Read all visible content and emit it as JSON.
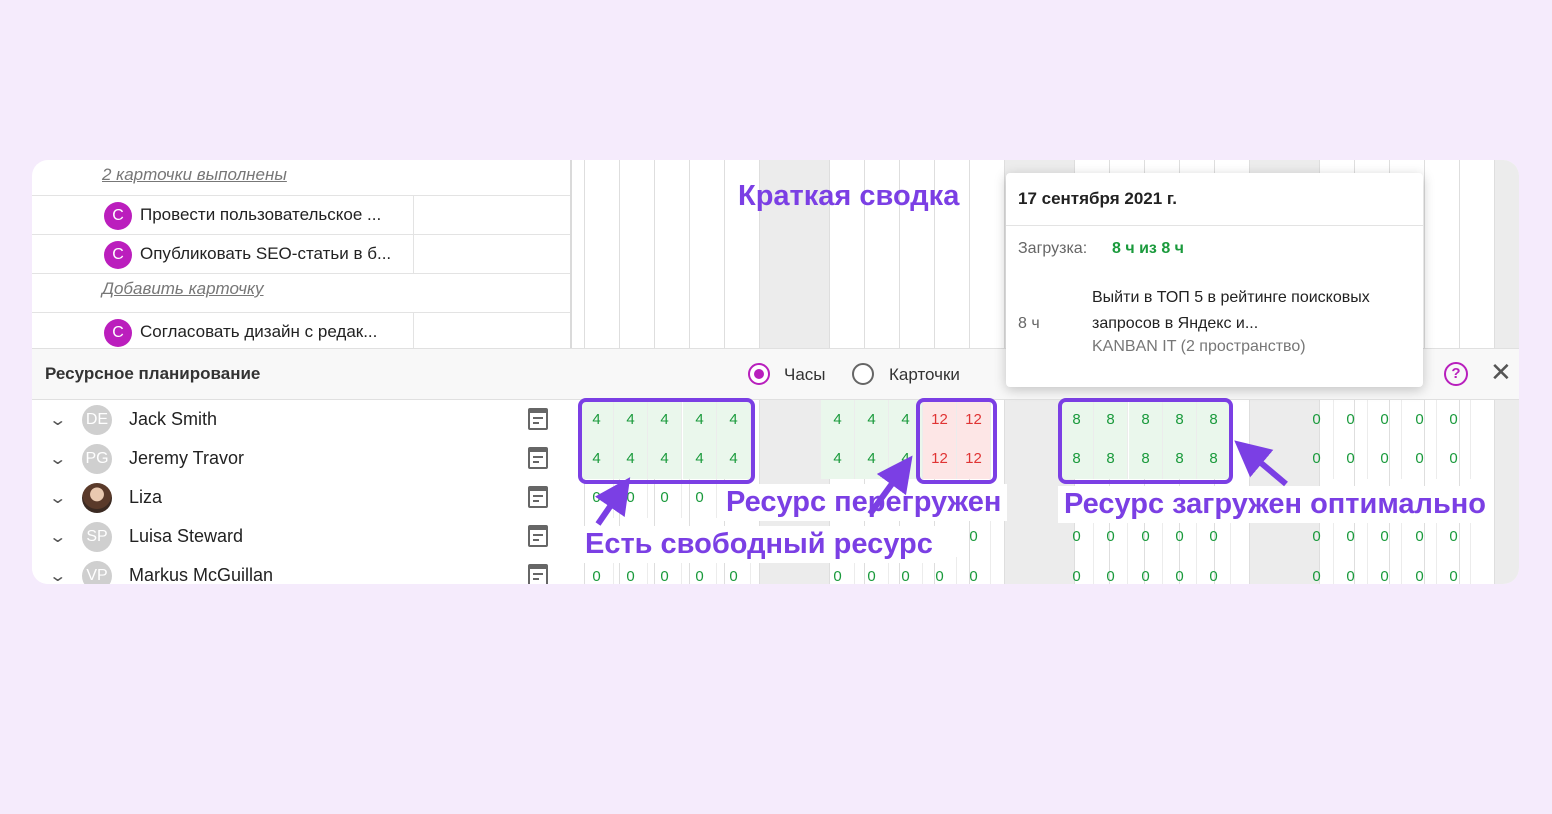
{
  "tasks": {
    "done_link": "2 карточки выполнены",
    "add_link": "Добавить карточку",
    "items": [
      {
        "badge": "C",
        "title": "Провести пользовательское ..."
      },
      {
        "badge": "C",
        "title": "Опубликовать SEO-статьи в б..."
      },
      {
        "badge": "C",
        "title": "Согласовать дизайн с редак..."
      }
    ]
  },
  "resource_bar": {
    "title": "Ресурсное планирование",
    "mode_hours": "Часы",
    "mode_cards": "Карточки",
    "selected_mode": "Часы",
    "help": "?",
    "close": "✕"
  },
  "people": [
    {
      "initials": "DE",
      "name": "Jack Smith"
    },
    {
      "initials": "PG",
      "name": "Jeremy Travor"
    },
    {
      "initials": "",
      "name": "Liza"
    },
    {
      "initials": "SP",
      "name": "Luisa Steward"
    },
    {
      "initials": "VP",
      "name": "Markus McGuillan"
    }
  ],
  "grid": {
    "row1": [
      "4",
      "4",
      "4",
      "4",
      "4",
      "4",
      "4",
      "4",
      "12",
      "12",
      "8",
      "8",
      "8",
      "8",
      "8",
      "0",
      "0",
      "0",
      "0",
      "0"
    ],
    "row2": [
      "4",
      "4",
      "4",
      "4",
      "4",
      "4",
      "4",
      "4",
      "12",
      "12",
      "8",
      "8",
      "8",
      "8",
      "8",
      "0",
      "0",
      "0",
      "0",
      "0"
    ],
    "row3": [
      "0",
      "0",
      "0",
      "0"
    ],
    "row4": [
      "0",
      "0",
      "0",
      "0",
      "0",
      "0",
      "0",
      "0",
      "0",
      "0",
      "0",
      "0",
      "0",
      "0",
      "0"
    ],
    "row5": [
      "0",
      "0",
      "0",
      "0",
      "0",
      "0",
      "0",
      "0",
      "0",
      "0",
      "0",
      "0",
      "0",
      "0",
      "0",
      "0",
      "0",
      "0",
      "0",
      "0"
    ]
  },
  "tooltip": {
    "date": "17 сентября 2021 г.",
    "load_label": "Загрузка:",
    "load_value": "8 ч из 8 ч",
    "task_hours": "8 ч",
    "task_title": "Выйти в ТОП 5 в рейтинге поисковых запросов в Яндекс и...",
    "task_space": "KANBAN IT (2 пространство)"
  },
  "annotations": {
    "summary": "Краткая сводка",
    "free": "Есть свободный ресурс",
    "overloaded": "Ресурс перегружен",
    "optimal": "Ресурс загружен оптимально"
  },
  "colors": {
    "accent": "#7b3fe4",
    "brand": "#b81fbd",
    "ok": "#1a9a3c",
    "overload": "#e03434"
  }
}
